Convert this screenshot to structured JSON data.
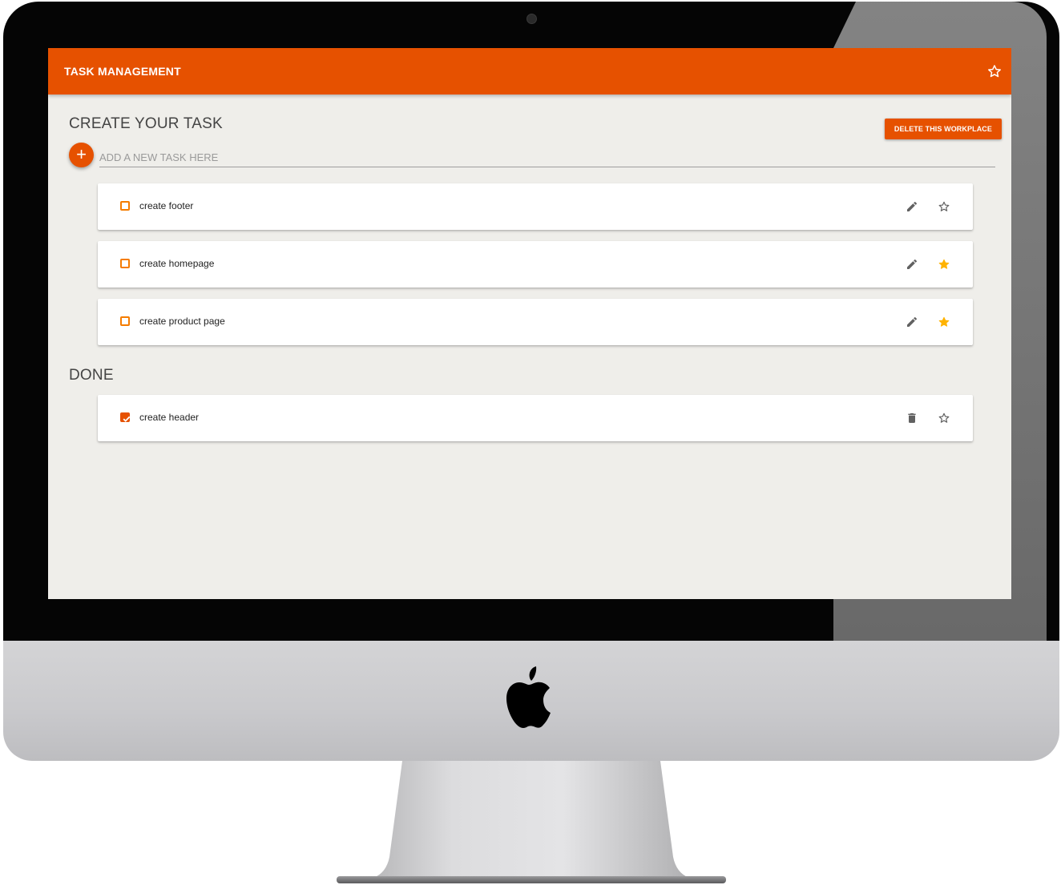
{
  "app": {
    "title": "TASK MANAGEMENT",
    "header_star_icon": "star-outline-icon",
    "accent_color": "#e65100"
  },
  "create": {
    "title": "CREATE YOUR TASK",
    "delete_label": "DELETE THIS WORKPLACE",
    "add_icon": "+",
    "input_placeholder": "ADD A NEW TASK HERE",
    "input_value": ""
  },
  "tasks": [
    {
      "label": "create footer",
      "done": false,
      "starred": false,
      "action_icon": "pencil-icon"
    },
    {
      "label": "create homepage",
      "done": false,
      "starred": true,
      "action_icon": "pencil-icon"
    },
    {
      "label": "create product page",
      "done": false,
      "starred": true,
      "action_icon": "pencil-icon"
    }
  ],
  "done": {
    "title": "DONE",
    "tasks": [
      {
        "label": "create header",
        "done": true,
        "starred": false,
        "action_icon": "trash-icon"
      }
    ]
  },
  "colors": {
    "star_active": "#ffb300",
    "star_inactive": "#616161",
    "screen_bg": "#efeeea"
  }
}
